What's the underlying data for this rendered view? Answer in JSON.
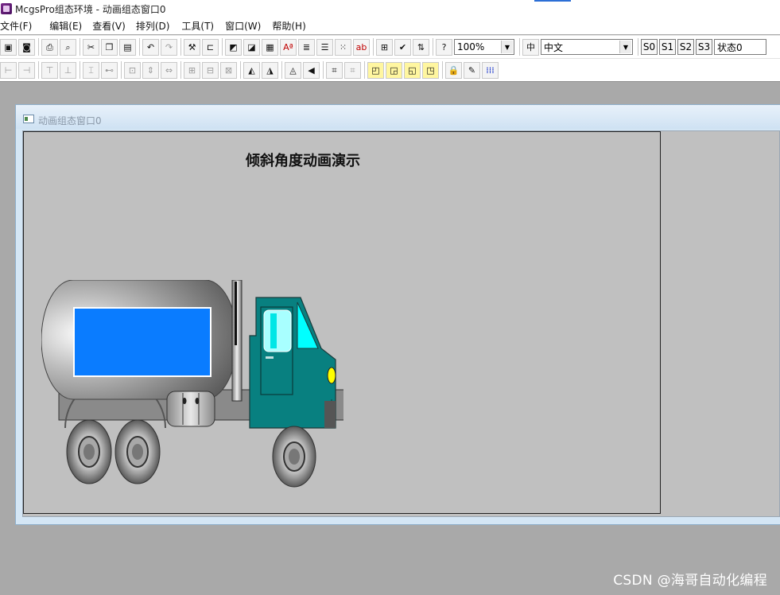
{
  "app": {
    "title": "McgsPro组态环境 - 动画组态窗口0"
  },
  "menu": {
    "items": [
      "文件(F)",
      "编辑(E)",
      "查看(V)",
      "排列(D)",
      "工具(T)",
      "窗口(W)",
      "帮助(H)"
    ]
  },
  "toolbar1": {
    "zoom_value": "100%",
    "language_value": "中文",
    "state_buttons": [
      "S0",
      "S1",
      "S2",
      "S3"
    ],
    "state_field_value": "状态0"
  },
  "child_window": {
    "title": "动画组态窗口0"
  },
  "canvas": {
    "title": "倾斜角度动画演示"
  },
  "watermark": {
    "text": "CSDN @海哥自动化编程"
  },
  "colors": {
    "tank_window": "#0a7cff",
    "cab": "#088080",
    "cab_window": "#00ffff",
    "headlight": "#ffff00"
  }
}
